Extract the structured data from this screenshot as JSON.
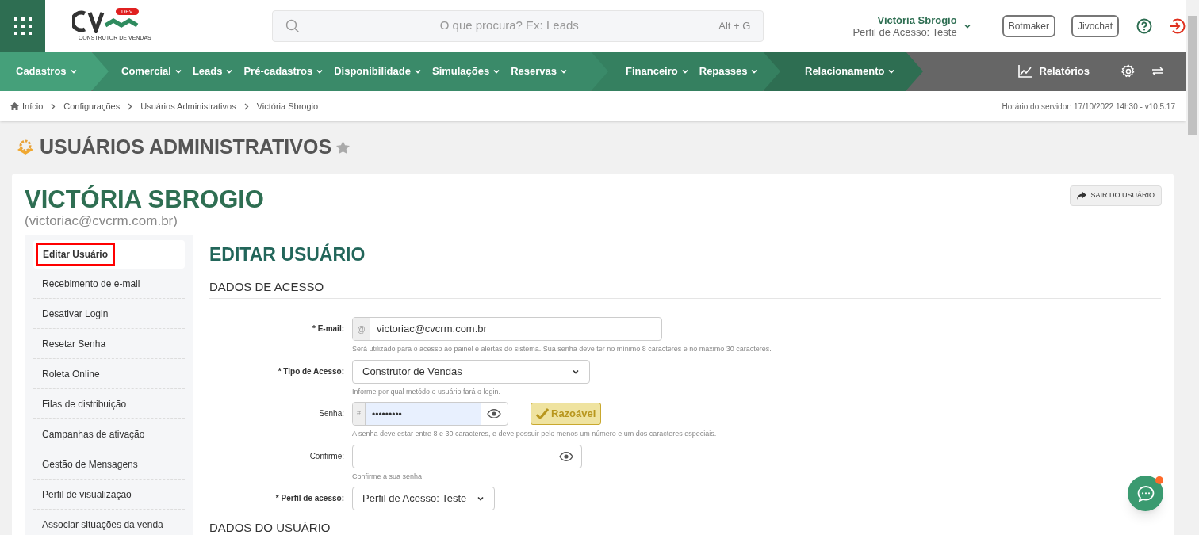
{
  "header": {
    "logo_badge": "DEV",
    "logo_tagline": "CONSTRUTOR DE VENDAS",
    "search": {
      "placeholder": "O que procura? Ex: Leads",
      "shortcut": "Alt + G"
    },
    "user": {
      "name": "Victória Sbrogio",
      "profile": "Perfil de Acesso: Teste"
    },
    "buttons": [
      "Botmaker",
      "Jivochat"
    ]
  },
  "nav": {
    "groups": [
      [
        {
          "label": "Cadastros"
        }
      ],
      [
        {
          "label": "Comercial"
        },
        {
          "label": "Leads"
        },
        {
          "label": "Pré-cadastros"
        },
        {
          "label": "Disponibilidade"
        },
        {
          "label": "Simulações"
        },
        {
          "label": "Reservas"
        }
      ],
      [
        {
          "label": "Financeiro"
        },
        {
          "label": "Repasses"
        }
      ],
      [
        {
          "label": "Relacionamento"
        }
      ]
    ],
    "reports": "Relatórios"
  },
  "breadcrumb": [
    "Início",
    "Configurações",
    "Usuários Administrativos",
    "Victória Sbrogio"
  ],
  "server_time": "Horário do servidor: 17/10/2022 14h30 - v10.5.17",
  "page_title": "USUÁRIOS ADMINISTRATIVOS",
  "user_card": {
    "name": "VICTÓRIA SBROGIO",
    "email": "(victoriac@cvcrm.com.br)",
    "exit_button": "SAIR DO USUÁRIO"
  },
  "sidebar": {
    "items": [
      {
        "label": "Editar Usuário",
        "selected": true
      },
      {
        "label": "Recebimento de e-mail",
        "selected": false
      },
      {
        "label": "Desativar Login",
        "selected": false
      },
      {
        "label": "Resetar Senha",
        "selected": false
      },
      {
        "label": "Roleta Online",
        "selected": false
      },
      {
        "label": "Filas de distribuição",
        "selected": false
      },
      {
        "label": "Campanhas de ativação",
        "selected": false
      },
      {
        "label": "Gestão de Mensagens",
        "selected": false
      },
      {
        "label": "Perfil de visualização",
        "selected": false
      },
      {
        "label": "Associar situações da venda",
        "selected": false
      }
    ]
  },
  "form": {
    "title": "EDITAR USUÁRIO",
    "sections": [
      {
        "title": "DADOS DE ACESSO",
        "fields": [
          {
            "kind": "text",
            "label": "* E-mail:",
            "required": true,
            "addon": "@",
            "value": "victoriac@cvcrm.com.br",
            "help": "Será utilizado para o acesso ao painel e alertas do sistema. Sua senha deve ter no mínimo 8 caracteres e no máximo 30 caracteres."
          },
          {
            "kind": "select",
            "label": "* Tipo de Acesso:",
            "required": true,
            "value": "Construtor de Vendas",
            "help": "Informe por qual metódo o usuário fará o login."
          },
          {
            "kind": "password",
            "label": "Senha:",
            "required": false,
            "addon": "#",
            "value": "•••••••••",
            "strength": "Razoável",
            "help": "A senha deve estar entre 8 e 30 caracteres, e deve possuir pelo menos um número e um dos caracteres especiais."
          },
          {
            "kind": "confirm",
            "label": "Confirme:",
            "required": false,
            "help": "Confirme a sua senha"
          },
          {
            "kind": "select_small",
            "label": "* Perfil de acesso:",
            "required": true,
            "value": "Perfil de Acesso: Teste"
          }
        ]
      },
      {
        "title": "DADOS DO USUÁRIO"
      }
    ]
  }
}
